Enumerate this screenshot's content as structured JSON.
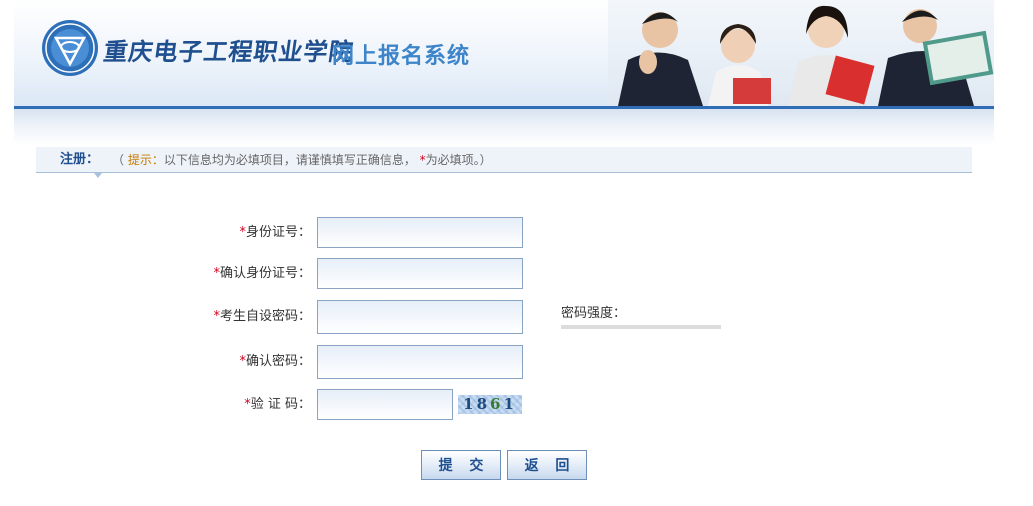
{
  "banner": {
    "school_name": "重庆电子工程职业学院",
    "system_name": "网上报名系统"
  },
  "notice": {
    "title": "注册：",
    "open_paren": "（ ",
    "hint_label": "提示：",
    "hint_text": "以下信息均为必填项目，请谨慎填写正确信息， ",
    "star": "*",
    "star_text": "为必填项。）"
  },
  "form": {
    "required_mark": "*",
    "fields": [
      {
        "label": "身份证号：",
        "value": ""
      },
      {
        "label": "确认身份证号：",
        "value": ""
      },
      {
        "label": "考生自设密码：",
        "value": ""
      },
      {
        "label": "确认密码：",
        "value": ""
      },
      {
        "label": "验 证 码：",
        "value": ""
      }
    ],
    "password_strength_label": "密码强度：",
    "captcha": {
      "d1": "1",
      "d2": "8",
      "d3": "6",
      "d4": "1"
    }
  },
  "buttons": {
    "submit": "提 交",
    "back": "返 回"
  },
  "colors": {
    "accent": "#2f6db6",
    "title_blue": "#3d84c9",
    "required_red": "#d0021b",
    "hint_orange": "#c57a00"
  }
}
